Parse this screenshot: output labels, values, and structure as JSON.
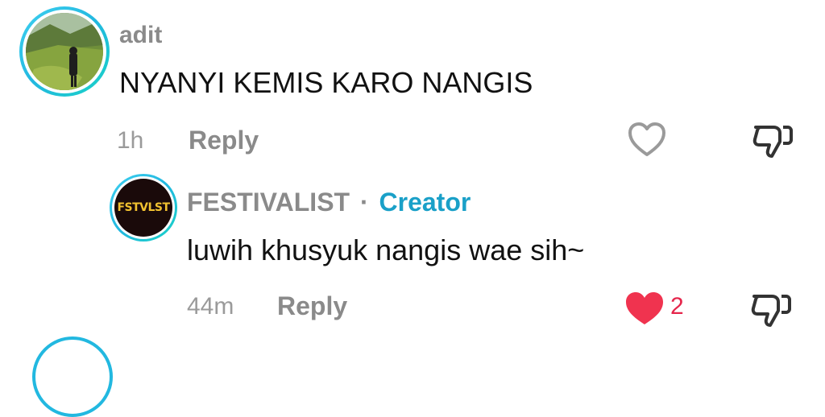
{
  "comments": [
    {
      "username": "adit",
      "text": "NYANYI KEMIS KARO NANGIS",
      "time": "1h",
      "reply_label": "Reply",
      "like_count": "",
      "liked": false,
      "avatar_icon": "landscape-photo"
    }
  ],
  "reply": {
    "username": "FESTIVALIST",
    "separator": "·",
    "badge": "Creator",
    "text": "luwih khusyuk nangis wae sih~",
    "time": "44m",
    "reply_label": "Reply",
    "like_count": "2",
    "liked": true,
    "avatar_logo_text": "FSTVLST",
    "avatar_icon": "festivalist-logo"
  },
  "colors": {
    "ring": "#22b8e0",
    "creator": "#1aa0c8",
    "like": "#e5254b",
    "muted": "#8a8a8a"
  }
}
